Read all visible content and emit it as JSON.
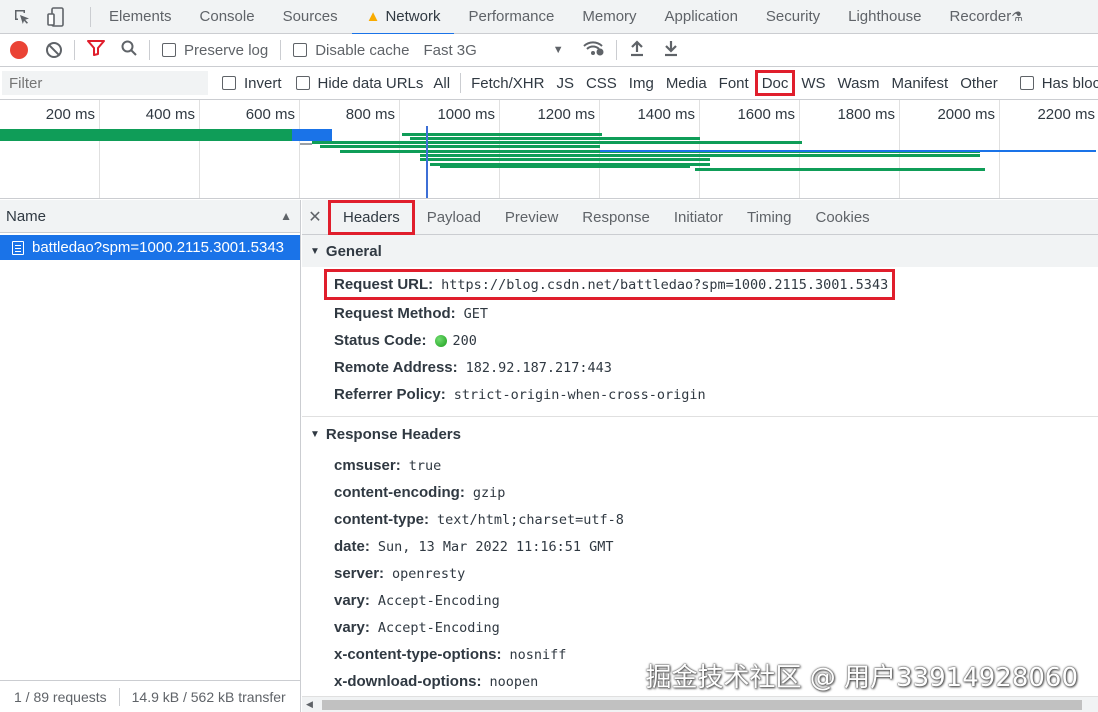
{
  "top_tabs": [
    "Elements",
    "Console",
    "Sources",
    "Network",
    "Performance",
    "Memory",
    "Application",
    "Security",
    "Lighthouse",
    "Recorder"
  ],
  "toolbar": {
    "preserve_log": "Preserve log",
    "disable_cache": "Disable cache",
    "throttle": "Fast 3G"
  },
  "filterbar": {
    "placeholder": "Filter",
    "invert": "Invert",
    "hide_data_urls": "Hide data URLs",
    "types": [
      "All",
      "Fetch/XHR",
      "JS",
      "CSS",
      "Img",
      "Media",
      "Font",
      "Doc",
      "WS",
      "Wasm",
      "Manifest",
      "Other"
    ],
    "highlighted_type": "Doc",
    "has_blocked": "Has blocked"
  },
  "timeline": {
    "ticks": [
      "200 ms",
      "400 ms",
      "600 ms",
      "800 ms",
      "1000 ms",
      "1200 ms",
      "1400 ms",
      "1600 ms",
      "1800 ms",
      "2000 ms",
      "2200 ms"
    ]
  },
  "requests": {
    "column_name": "Name",
    "selected": "battledao?spm=1000.2115.3001.5343",
    "count_text": "1 / 89 requests",
    "transfer_text": "14.9 kB / 562 kB transfer"
  },
  "details": {
    "tabs": [
      "Headers",
      "Payload",
      "Preview",
      "Response",
      "Initiator",
      "Timing",
      "Cookies"
    ],
    "active_tab": "Headers",
    "general_title": "General",
    "general": [
      {
        "k": "Request URL:",
        "v": "https://blog.csdn.net/battledao?spm=1000.2115.3001.5343"
      },
      {
        "k": "Request Method:",
        "v": "GET"
      },
      {
        "k": "Status Code:",
        "v": "200"
      },
      {
        "k": "Remote Address:",
        "v": "182.92.187.217:443"
      },
      {
        "k": "Referrer Policy:",
        "v": "strict-origin-when-cross-origin"
      }
    ],
    "response_title": "Response Headers",
    "response_headers": [
      {
        "k": "cmsuser:",
        "v": "true"
      },
      {
        "k": "content-encoding:",
        "v": "gzip"
      },
      {
        "k": "content-type:",
        "v": "text/html;charset=utf-8"
      },
      {
        "k": "date:",
        "v": "Sun, 13 Mar 2022 11:16:51 GMT"
      },
      {
        "k": "server:",
        "v": "openresty"
      },
      {
        "k": "vary:",
        "v": "Accept-Encoding"
      },
      {
        "k": "vary:",
        "v": "Accept-Encoding"
      },
      {
        "k": "x-content-type-options:",
        "v": "nosniff"
      },
      {
        "k": "x-download-options:",
        "v": "noopen"
      }
    ]
  },
  "watermark": "掘金技术社区 @ 用户3391492806​0",
  "colors": {
    "accent": "#1a73e8",
    "highlight": "#e01e2c",
    "waterfall": "#0f9d58"
  }
}
